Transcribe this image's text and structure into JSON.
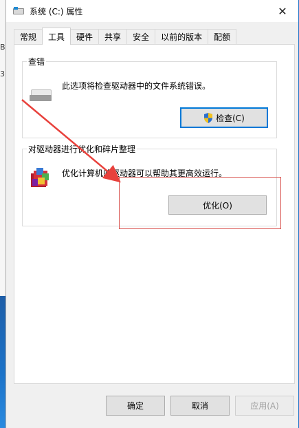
{
  "window": {
    "title": "系统 (C:) 属性",
    "close_glyph": "✕"
  },
  "tabs": [
    {
      "label": "常规"
    },
    {
      "label": "工具"
    },
    {
      "label": "硬件"
    },
    {
      "label": "共享"
    },
    {
      "label": "安全"
    },
    {
      "label": "以前的版本"
    },
    {
      "label": "配额"
    }
  ],
  "active_tab": "工具",
  "check_group": {
    "title": "查错",
    "description": "此选项将检查驱动器中的文件系统错误。",
    "button_label": "检查(C)"
  },
  "optimize_group": {
    "title": "对驱动器进行优化和碎片整理",
    "description": "优化计算机的驱动器可以帮助其更高效运行。",
    "button_label": "优化(O)"
  },
  "footer": {
    "ok_label": "确定",
    "cancel_label": "取消",
    "apply_label": "应用(A)"
  },
  "background": {
    "left_letters": [
      "B",
      "3"
    ]
  },
  "colors": {
    "focus_border": "#0078d7",
    "annotation_red": "#d9534f",
    "arrow_red": "#e8413c"
  },
  "icons": [
    "drive-icon",
    "shield-icon",
    "defrag-icon",
    "close-icon"
  ]
}
